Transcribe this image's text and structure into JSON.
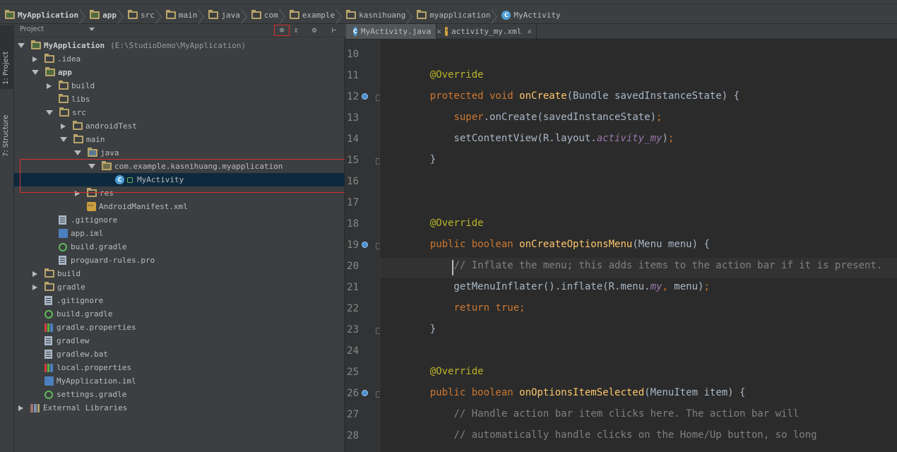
{
  "breadcrumb": [
    {
      "label": "MyApplication",
      "icon": "module-folder-icon",
      "bold": true
    },
    {
      "label": "app",
      "icon": "module-folder-icon",
      "bold": true
    },
    {
      "label": "src",
      "icon": "folder-icon"
    },
    {
      "label": "main",
      "icon": "folder-icon"
    },
    {
      "label": "java",
      "icon": "folder-icon"
    },
    {
      "label": "com",
      "icon": "folder-icon"
    },
    {
      "label": "example",
      "icon": "folder-icon"
    },
    {
      "label": "kasnihuang",
      "icon": "folder-icon"
    },
    {
      "label": "myapplication",
      "icon": "folder-icon"
    },
    {
      "label": "MyActivity",
      "icon": "class-icon"
    }
  ],
  "toolwindows": {
    "project_tab": "1: Project",
    "structure_tab": "7: Structure"
  },
  "project": {
    "view_selector": "Project",
    "tree": [
      {
        "label": "MyApplication",
        "path": "(E:\\StudioDemo\\MyApplication)",
        "depth": 0,
        "arrow": "down",
        "icon": "module",
        "bold": true
      },
      {
        "label": ".idea",
        "depth": 1,
        "arrow": "right",
        "icon": "folder"
      },
      {
        "label": "app",
        "depth": 1,
        "arrow": "down",
        "icon": "module",
        "bold": true
      },
      {
        "label": "build",
        "depth": 2,
        "arrow": "right",
        "icon": "folder"
      },
      {
        "label": "libs",
        "depth": 2,
        "arrow": "none",
        "icon": "folder"
      },
      {
        "label": "src",
        "depth": 2,
        "arrow": "down",
        "icon": "folder"
      },
      {
        "label": "androidTest",
        "depth": 3,
        "arrow": "right",
        "icon": "folder"
      },
      {
        "label": "main",
        "depth": 3,
        "arrow": "down",
        "icon": "folder"
      },
      {
        "label": "java",
        "depth": 4,
        "arrow": "down",
        "icon": "src"
      },
      {
        "label": "com.example.kasnihuang.myapplication",
        "depth": 5,
        "arrow": "down",
        "icon": "pkg"
      },
      {
        "label": "MyActivity",
        "depth": 6,
        "arrow": "none",
        "icon": "class",
        "selected": true
      },
      {
        "label": "res",
        "depth": 4,
        "arrow": "right",
        "icon": "folder"
      },
      {
        "label": "AndroidManifest.xml",
        "depth": 4,
        "arrow": "none",
        "icon": "xml"
      },
      {
        "label": ".gitignore",
        "depth": 2,
        "arrow": "none",
        "icon": "file"
      },
      {
        "label": "app.iml",
        "depth": 2,
        "arrow": "none",
        "icon": "iml"
      },
      {
        "label": "build.gradle",
        "depth": 2,
        "arrow": "none",
        "icon": "gradle"
      },
      {
        "label": "proguard-rules.pro",
        "depth": 2,
        "arrow": "none",
        "icon": "file"
      },
      {
        "label": "build",
        "depth": 1,
        "arrow": "right",
        "icon": "folder"
      },
      {
        "label": "gradle",
        "depth": 1,
        "arrow": "right",
        "icon": "folder"
      },
      {
        "label": ".gitignore",
        "depth": 1,
        "arrow": "none",
        "icon": "file"
      },
      {
        "label": "build.gradle",
        "depth": 1,
        "arrow": "none",
        "icon": "gradle"
      },
      {
        "label": "gradle.properties",
        "depth": 1,
        "arrow": "none",
        "icon": "props"
      },
      {
        "label": "gradlew",
        "depth": 1,
        "arrow": "none",
        "icon": "file"
      },
      {
        "label": "gradlew.bat",
        "depth": 1,
        "arrow": "none",
        "icon": "file"
      },
      {
        "label": "local.properties",
        "depth": 1,
        "arrow": "none",
        "icon": "props"
      },
      {
        "label": "MyApplication.iml",
        "depth": 1,
        "arrow": "none",
        "icon": "iml"
      },
      {
        "label": "settings.gradle",
        "depth": 1,
        "arrow": "none",
        "icon": "gradle"
      },
      {
        "label": "External Libraries",
        "depth": 0,
        "arrow": "right",
        "icon": "libs"
      }
    ]
  },
  "tabs": [
    {
      "label": "MyActivity.java",
      "icon": "class",
      "active": true
    },
    {
      "label": "activity_my.xml",
      "icon": "xml",
      "active": false
    }
  ],
  "editor": {
    "lines": [
      {
        "n": "10",
        "tokens": []
      },
      {
        "n": "11",
        "tokens": [
          {
            "t": "    "
          },
          {
            "t": "@Override",
            "c": "an"
          }
        ]
      },
      {
        "n": "12",
        "marker": true,
        "fold": true,
        "tokens": [
          {
            "t": "    "
          },
          {
            "t": "protected void ",
            "c": "kw"
          },
          {
            "t": "onCreate",
            "c": "fn"
          },
          {
            "t": "(Bundle savedInstanceState) {"
          }
        ]
      },
      {
        "n": "13",
        "tokens": [
          {
            "t": "        "
          },
          {
            "t": "super",
            "c": "kw"
          },
          {
            "t": "."
          },
          {
            "t": "onCreate"
          },
          {
            "t": "(savedInstanceState)"
          },
          {
            "t": ";",
            "c": "kw"
          }
        ]
      },
      {
        "n": "14",
        "tokens": [
          {
            "t": "        setContentView(R.layout."
          },
          {
            "t": "activity_my",
            "c": "it"
          },
          {
            "t": ")"
          },
          {
            "t": ";",
            "c": "kw"
          }
        ]
      },
      {
        "n": "15",
        "fold": true,
        "tokens": [
          {
            "t": "    }"
          }
        ]
      },
      {
        "n": "16",
        "tokens": []
      },
      {
        "n": "17",
        "tokens": []
      },
      {
        "n": "18",
        "tokens": [
          {
            "t": "    "
          },
          {
            "t": "@Override",
            "c": "an"
          }
        ]
      },
      {
        "n": "19",
        "marker": true,
        "fold": true,
        "tokens": [
          {
            "t": "    "
          },
          {
            "t": "public boolean ",
            "c": "kw"
          },
          {
            "t": "onCreateOptionsMenu",
            "c": "fn"
          },
          {
            "t": "(Menu menu) {"
          }
        ]
      },
      {
        "n": "20",
        "tokens": [
          {
            "t": "        "
          },
          {
            "t": "// Inflate the menu; this adds items to the action bar if it is present.",
            "c": "cm"
          }
        ]
      },
      {
        "n": "21",
        "tokens": [
          {
            "t": "        getMenuInflater().inflate(R.menu."
          },
          {
            "t": "my",
            "c": "it"
          },
          {
            "t": ", ",
            "c": "kw"
          },
          {
            "t": "menu)"
          },
          {
            "t": ";",
            "c": "kw"
          }
        ]
      },
      {
        "n": "22",
        "tokens": [
          {
            "t": "        "
          },
          {
            "t": "return true",
            "c": "kw"
          },
          {
            "t": ";",
            "c": "kw"
          }
        ]
      },
      {
        "n": "23",
        "fold": true,
        "tokens": [
          {
            "t": "    }"
          }
        ]
      },
      {
        "n": "24",
        "tokens": []
      },
      {
        "n": "25",
        "tokens": [
          {
            "t": "    "
          },
          {
            "t": "@Override",
            "c": "an"
          }
        ]
      },
      {
        "n": "26",
        "marker": true,
        "fold": true,
        "tokens": [
          {
            "t": "    "
          },
          {
            "t": "public boolean ",
            "c": "kw"
          },
          {
            "t": "onOptionsItemSelected",
            "c": "fn"
          },
          {
            "t": "(MenuItem item) {"
          }
        ]
      },
      {
        "n": "27",
        "tokens": [
          {
            "t": "        "
          },
          {
            "t": "// Handle action bar item clicks here. The action bar will",
            "c": "cm"
          }
        ]
      },
      {
        "n": "28",
        "tokens": [
          {
            "t": "        "
          },
          {
            "t": "// automatically handle clicks on the Home/Up button, so long",
            "c": "cm"
          }
        ]
      }
    ]
  },
  "colors": {
    "selection": "#0d293e",
    "highlight_box": "#d83030",
    "keyword": "#cc7832",
    "annotation": "#bbb529",
    "method": "#ffc66d",
    "comment": "#808080"
  }
}
